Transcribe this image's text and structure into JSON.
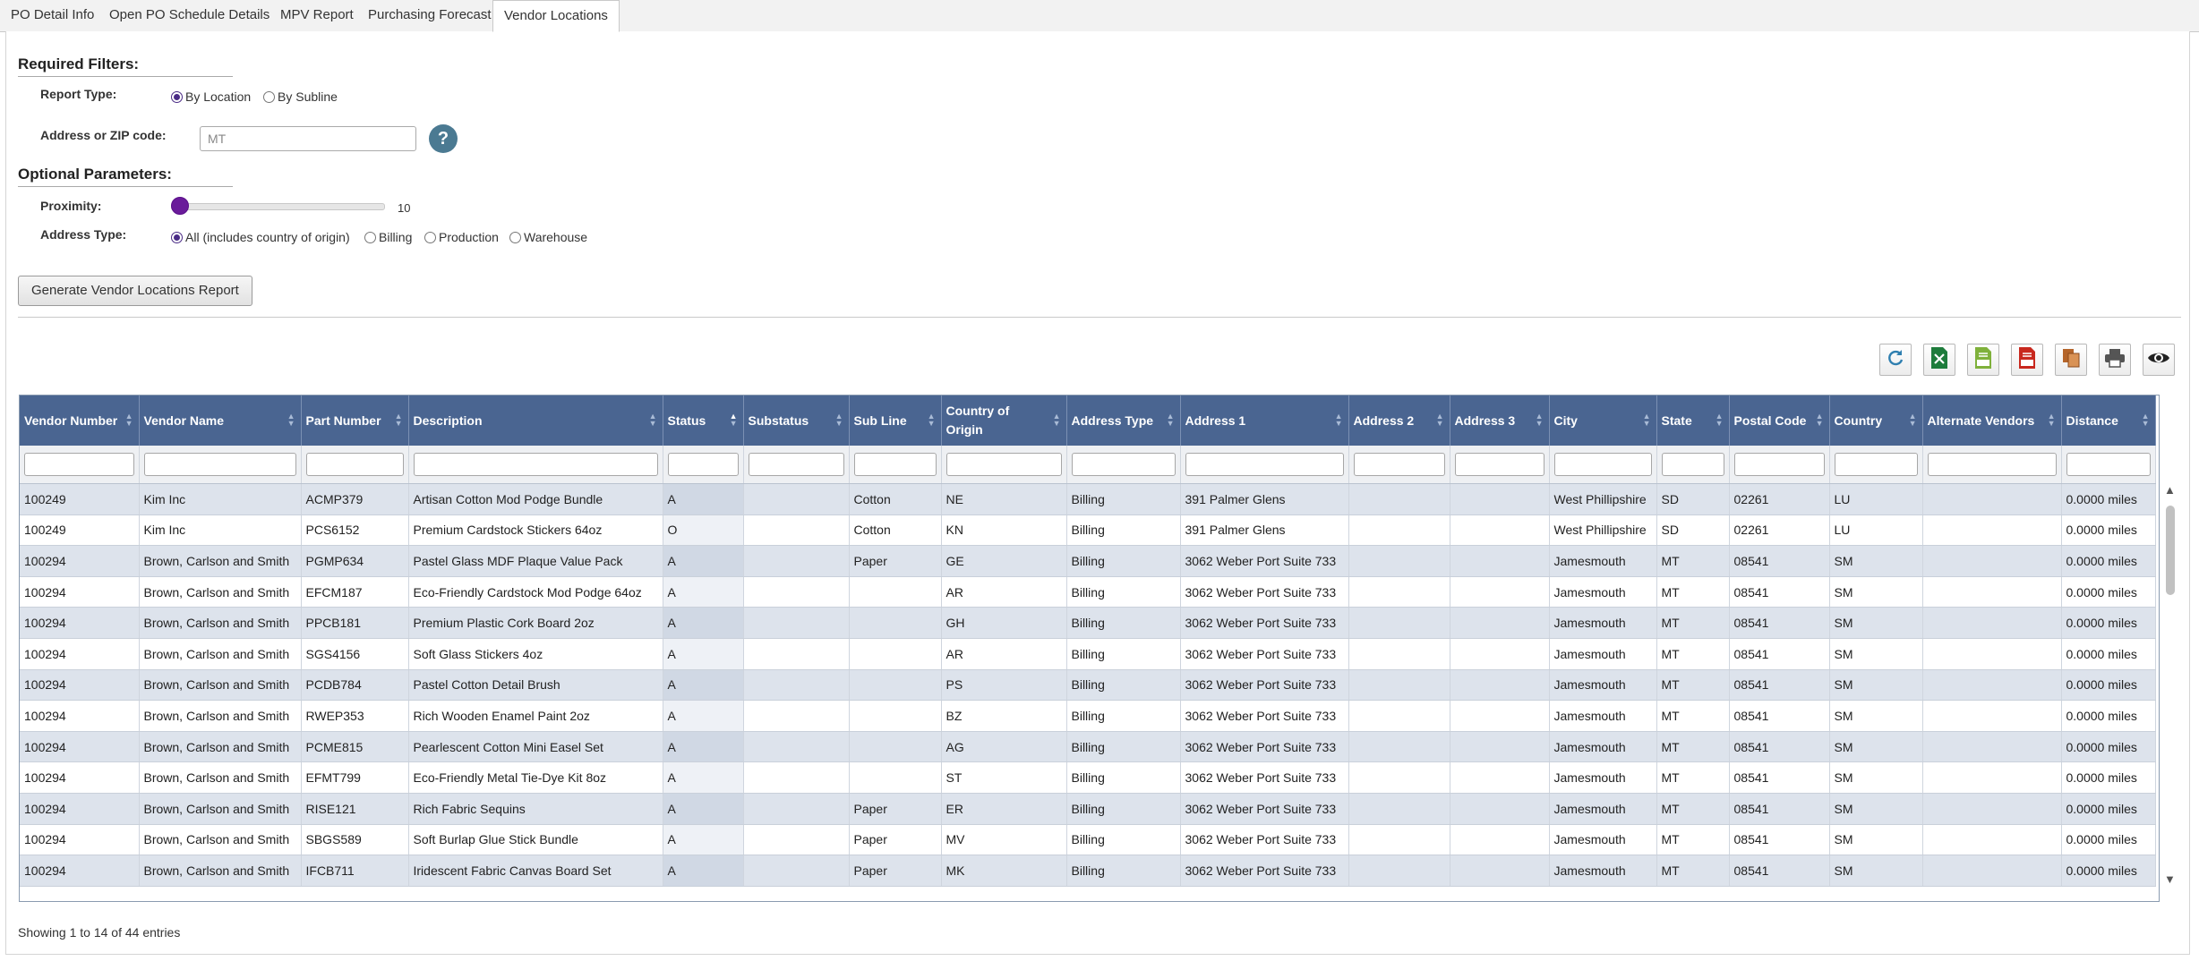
{
  "tabs": [
    {
      "label": "PO Detail Info"
    },
    {
      "label": "Open PO Schedule Details"
    },
    {
      "label": "MPV Report"
    },
    {
      "label": "Purchasing Forecast"
    },
    {
      "label": "Vendor Locations",
      "active": true
    }
  ],
  "filters": {
    "required_title": "Required Filters:",
    "report_type_label": "Report Type:",
    "report_type_options": [
      "By Location",
      "By Subline"
    ],
    "report_type_selected": "By Location",
    "address_label": "Address or ZIP code:",
    "address_value": "MT",
    "help_label": "?"
  },
  "optional": {
    "title": "Optional Parameters:",
    "proximity_label": "Proximity:",
    "proximity_value": "10",
    "proximity_level": 0.0,
    "address_type_label": "Address Type:",
    "address_type_options": [
      "All (includes country of origin)",
      "Billing",
      "Production",
      "Warehouse"
    ],
    "address_type_selected": "All (includes country of origin)"
  },
  "generate_button": "Generate Vendor Locations Report",
  "toolbar": {
    "icons": [
      "refresh-icon",
      "excel-export-icon",
      "csv-export-icon",
      "pdf-export-icon",
      "copy-icon",
      "print-icon",
      "column-visibility-icon"
    ]
  },
  "table": {
    "columns": [
      "Vendor Number",
      "Vendor Name",
      "Part Number",
      "Description",
      "Status",
      "Substatus",
      "Sub Line",
      "Country of Origin",
      "Address Type",
      "Address 1",
      "Address 2",
      "Address 3",
      "City",
      "State",
      "Postal Code",
      "Country",
      "Alternate Vendors",
      "Distance"
    ],
    "sorted_column": "Status",
    "rows": [
      [
        "100249",
        "Kim Inc",
        "ACMP379",
        "Artisan Cotton Mod Podge Bundle",
        "A",
        "",
        "Cotton",
        "NE",
        "Billing",
        "391 Palmer Glens",
        "",
        "",
        "West Phillipshire",
        "SD",
        "02261",
        "LU",
        "",
        "0.0000 miles"
      ],
      [
        "100249",
        "Kim Inc",
        "PCS6152",
        "Premium Cardstock Stickers 64oz",
        "O",
        "",
        "Cotton",
        "KN",
        "Billing",
        "391 Palmer Glens",
        "",
        "",
        "West Phillipshire",
        "SD",
        "02261",
        "LU",
        "",
        "0.0000 miles"
      ],
      [
        "100294",
        "Brown, Carlson and Smith",
        "PGMP634",
        "Pastel Glass MDF Plaque Value Pack",
        "A",
        "",
        "Paper",
        "GE",
        "Billing",
        "3062 Weber Port Suite 733",
        "",
        "",
        "Jamesmouth",
        "MT",
        "08541",
        "SM",
        "",
        "0.0000 miles"
      ],
      [
        "100294",
        "Brown, Carlson and Smith",
        "EFCM187",
        "Eco-Friendly Cardstock Mod Podge 64oz",
        "A",
        "",
        "",
        "AR",
        "Billing",
        "3062 Weber Port Suite 733",
        "",
        "",
        "Jamesmouth",
        "MT",
        "08541",
        "SM",
        "",
        "0.0000 miles"
      ],
      [
        "100294",
        "Brown, Carlson and Smith",
        "PPCB181",
        "Premium Plastic Cork Board 2oz",
        "A",
        "",
        "",
        "GH",
        "Billing",
        "3062 Weber Port Suite 733",
        "",
        "",
        "Jamesmouth",
        "MT",
        "08541",
        "SM",
        "",
        "0.0000 miles"
      ],
      [
        "100294",
        "Brown, Carlson and Smith",
        "SGS4156",
        "Soft Glass Stickers 4oz",
        "A",
        "",
        "",
        "AR",
        "Billing",
        "3062 Weber Port Suite 733",
        "",
        "",
        "Jamesmouth",
        "MT",
        "08541",
        "SM",
        "",
        "0.0000 miles"
      ],
      [
        "100294",
        "Brown, Carlson and Smith",
        "PCDB784",
        "Pastel Cotton Detail Brush",
        "A",
        "",
        "",
        "PS",
        "Billing",
        "3062 Weber Port Suite 733",
        "",
        "",
        "Jamesmouth",
        "MT",
        "08541",
        "SM",
        "",
        "0.0000 miles"
      ],
      [
        "100294",
        "Brown, Carlson and Smith",
        "RWEP353",
        "Rich Wooden Enamel Paint 2oz",
        "A",
        "",
        "",
        "BZ",
        "Billing",
        "3062 Weber Port Suite 733",
        "",
        "",
        "Jamesmouth",
        "MT",
        "08541",
        "SM",
        "",
        "0.0000 miles"
      ],
      [
        "100294",
        "Brown, Carlson and Smith",
        "PCME815",
        "Pearlescent Cotton Mini Easel Set",
        "A",
        "",
        "",
        "AG",
        "Billing",
        "3062 Weber Port Suite 733",
        "",
        "",
        "Jamesmouth",
        "MT",
        "08541",
        "SM",
        "",
        "0.0000 miles"
      ],
      [
        "100294",
        "Brown, Carlson and Smith",
        "EFMT799",
        "Eco-Friendly Metal Tie-Dye Kit 8oz",
        "A",
        "",
        "",
        "ST",
        "Billing",
        "3062 Weber Port Suite 733",
        "",
        "",
        "Jamesmouth",
        "MT",
        "08541",
        "SM",
        "",
        "0.0000 miles"
      ],
      [
        "100294",
        "Brown, Carlson and Smith",
        "RISE121",
        "Rich Fabric Sequins",
        "A",
        "",
        "Paper",
        "ER",
        "Billing",
        "3062 Weber Port Suite 733",
        "",
        "",
        "Jamesmouth",
        "MT",
        "08541",
        "SM",
        "",
        "0.0000 miles"
      ],
      [
        "100294",
        "Brown, Carlson and Smith",
        "SBGS589",
        "Soft Burlap Glue Stick Bundle",
        "A",
        "",
        "Paper",
        "MV",
        "Billing",
        "3062 Weber Port Suite 733",
        "",
        "",
        "Jamesmouth",
        "MT",
        "08541",
        "SM",
        "",
        "0.0000 miles"
      ],
      [
        "100294",
        "Brown, Carlson and Smith",
        "IFCB711",
        "Iridescent Fabric Canvas Board Set",
        "A",
        "",
        "Paper",
        "MK",
        "Billing",
        "3062 Weber Port Suite 733",
        "",
        "",
        "Jamesmouth",
        "MT",
        "08541",
        "SM",
        "",
        "0.0000 miles"
      ]
    ]
  },
  "footer": {
    "info": "Showing 1 to 14 of 44 entries"
  },
  "colors": {
    "header_bg": "#4a6591",
    "accent": "#6a1b9a",
    "help_bg": "#4b7a92"
  }
}
